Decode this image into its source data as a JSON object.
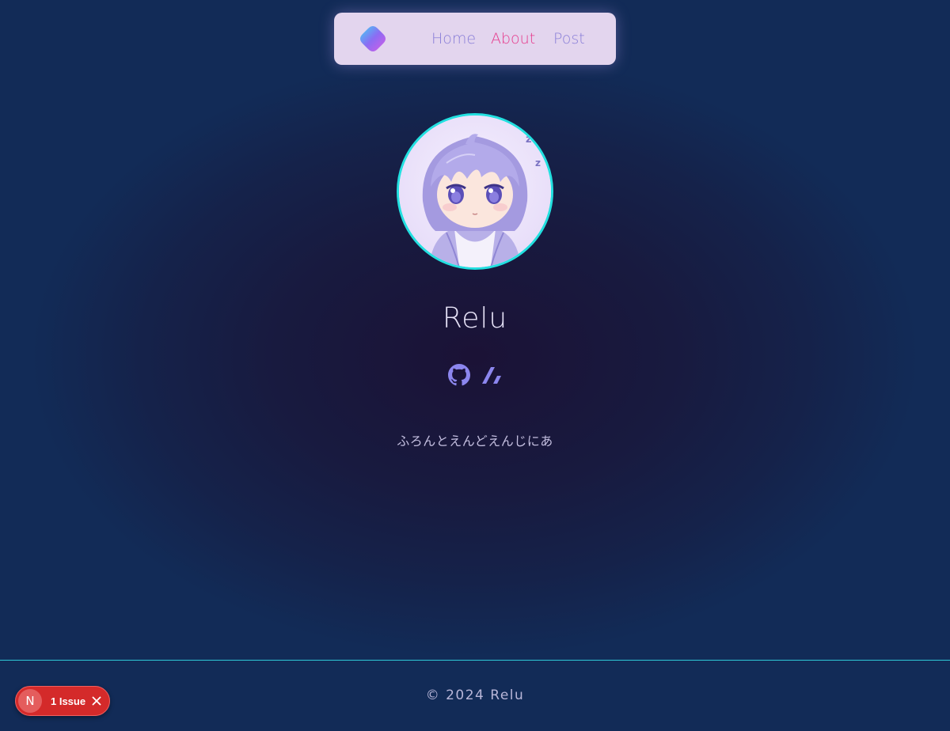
{
  "nav": {
    "logo_icon": "gradient-diamond-logo-icon",
    "links": [
      {
        "label": "Home",
        "active": false
      },
      {
        "label": "About",
        "active": true
      },
      {
        "label": "Post",
        "active": false
      }
    ],
    "active_color": "#e63a8c",
    "inactive_color": "#8a7fd8",
    "background": "#e3d5ee"
  },
  "profile": {
    "avatar_icon": "anime-boy-avatar",
    "avatar_border_color": "#22e0e0",
    "name": "Relu",
    "social_icons": [
      "github-icon",
      "zenn-icon"
    ],
    "bio": "ふろんとえんどえんじにあ"
  },
  "footer": {
    "text": "© 2024 Relu",
    "divider_color": "#2fc9d6"
  },
  "dev_indicator": {
    "badge_letter": "N",
    "label": "1 Issue",
    "color": "#d42a2a"
  }
}
